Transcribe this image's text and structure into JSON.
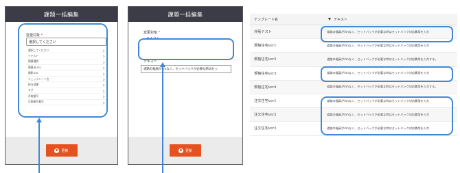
{
  "modal1": {
    "title": "課題一括編集",
    "field_label": "変更対象",
    "required_mark": "*",
    "select_value": "選択してください",
    "options": [
      "選択してください",
      "テキスト",
      "積算種別",
      "積算名URL",
      "撮影URL",
      "チェックシート名",
      "担当部署",
      "タグ",
      "月総番号",
      "月総番号番号"
    ],
    "button_label": "更新"
  },
  "modal2": {
    "title": "課題一括編集",
    "field_label": "変更対象",
    "required_mark": "*",
    "field_value": "テキスト",
    "text_label": "テキスト",
    "text_value": "道路の幅員が4mなく、セットバックが必要な時はセッ",
    "button_label": "更新"
  },
  "table": {
    "col_name": "テンプレート名",
    "col_text": "テキスト",
    "rows": [
      {
        "name": "外販テスト",
        "text": "道路の幅員が4mなく、セットバックが必要な時はセットバック対応費用を入力"
      },
      {
        "name": "規格住宅ver1",
        "text": "道路の幅員が4mなく、セットバックが必要な時はセットバック対応費用を入力"
      },
      {
        "name": "規格住宅ver2",
        "text": "道路の幅員が4mなく、セットバックが必要な時はセットバック対応費用を入力する。"
      },
      {
        "name": "規格住宅ver3",
        "text": "道路の幅員が4mなく、セットバックが必要な時はセットバック対応費用を入力"
      },
      {
        "name": "規格住宅ver4",
        "text": "道路の幅員が4mなく、セットバックが必要な時はセットバック対応費用を入力する。"
      },
      {
        "name": "注文住宅ver1",
        "text": "道路の幅員が4mなく、セットバックが必要な時はセットバック対応費用を入力"
      },
      {
        "name": "注文住宅ver2",
        "text": "道路の幅員が4mなく、セットバックが必要な時はセットバック対応費用を入力"
      },
      {
        "name": "注文住宅ver3",
        "text": "道路の幅員が4mなく、セットバックが必要な時はセットバック対応費用を入力"
      }
    ]
  },
  "colors": {
    "header_bg": "#3b3c46",
    "accent_button": "#e6521f",
    "highlight_ring": "#3f88d6"
  }
}
